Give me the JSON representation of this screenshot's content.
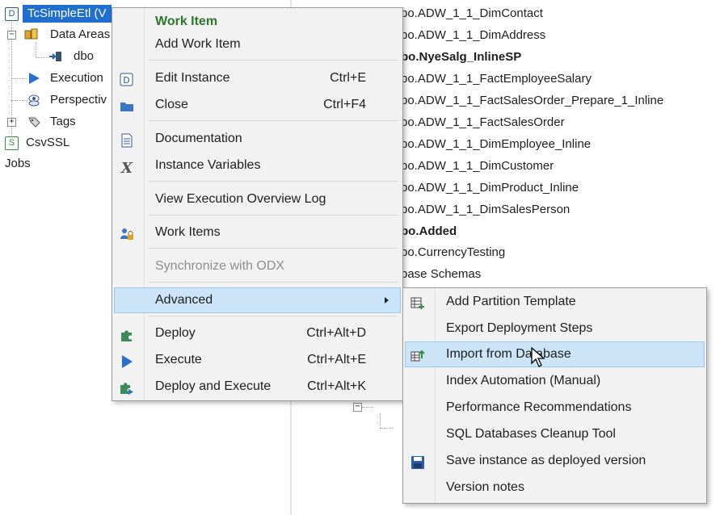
{
  "tree": {
    "root_label": "TcSimpleEtl (V",
    "root_badge": "D",
    "data_areas": "Data Areas",
    "dbo": "dbo",
    "execution": "Execution",
    "perspectives": "Perspectiv",
    "tags": "Tags",
    "csv_badge": "S",
    "csvssl": "CsvSSL",
    "jobs": "Jobs"
  },
  "right_list": [
    {
      "text": "bo.ADW_1_1_DimContact",
      "bold": false
    },
    {
      "text": "bo.ADW_1_1_DimAddress",
      "bold": false
    },
    {
      "text": "bo.NyeSalg_InlineSP",
      "bold": true
    },
    {
      "text": "bo.ADW_1_1_FactEmployeeSalary",
      "bold": false
    },
    {
      "text": "bo.ADW_1_1_FactSalesOrder_Prepare_1_Inline",
      "bold": false
    },
    {
      "text": "bo.ADW_1_1_FactSalesOrder",
      "bold": false
    },
    {
      "text": "bo.ADW_1_1_DimEmployee_Inline",
      "bold": false
    },
    {
      "text": "bo.ADW_1_1_DimCustomer",
      "bold": false
    },
    {
      "text": "bo.ADW_1_1_DimProduct_Inline",
      "bold": false
    },
    {
      "text": "bo.ADW_1_1_DimSalesPerson",
      "bold": false
    },
    {
      "text": "bo.Added",
      "bold": true
    },
    {
      "text": "bo.CurrencyTesting",
      "bold": false
    },
    {
      "text": "base Schemas",
      "bold": false
    }
  ],
  "context_menu": {
    "work_item_header": "Work Item",
    "add_work_item": "Add Work Item",
    "edit_instance": {
      "label": "Edit Instance",
      "shortcut": "Ctrl+E"
    },
    "close": {
      "label": "Close",
      "shortcut": "Ctrl+F4"
    },
    "documentation": "Documentation",
    "instance_variables": "Instance Variables",
    "view_execution_log": "View Execution Overview Log",
    "work_items": "Work Items",
    "synchronize_odx": "Synchronize with ODX",
    "advanced": "Advanced",
    "deploy": {
      "label": "Deploy",
      "shortcut": "Ctrl+Alt+D"
    },
    "execute": {
      "label": "Execute",
      "shortcut": "Ctrl+Alt+E"
    },
    "deploy_execute": {
      "label": "Deploy and Execute",
      "shortcut": "Ctrl+Alt+K"
    }
  },
  "advanced_submenu": {
    "add_partition_template": "Add Partition Template",
    "export_deployment_steps": "Export Deployment Steps",
    "import_from_database": "Import from Database",
    "index_automation": "Index Automation (Manual)",
    "performance_recommendations": "Performance Recommendations",
    "sql_cleanup_tool": "SQL Databases Cleanup Tool",
    "save_deployed_version": "Save instance as deployed version",
    "version_notes": "Version notes"
  },
  "colors": {
    "selection_blue": "#1f6fd0",
    "menu_highlight": "#cce4f7",
    "header_green": "#2b7a2b",
    "disabled_gray": "#8d8d8d"
  },
  "icons": {
    "edit_instance": "d-badge-icon",
    "close": "folder-icon",
    "documentation": "document-icon",
    "instance_variables": "x-variable-icon",
    "work_items": "users-lock-icon",
    "deploy": "puzzle-icon",
    "execute": "play-icon",
    "deploy_execute": "puzzle-play-icon",
    "add_partition_template": "partition-icon",
    "import_from_database": "import-icon",
    "save_deployed_version": "floppy-disk-icon"
  }
}
